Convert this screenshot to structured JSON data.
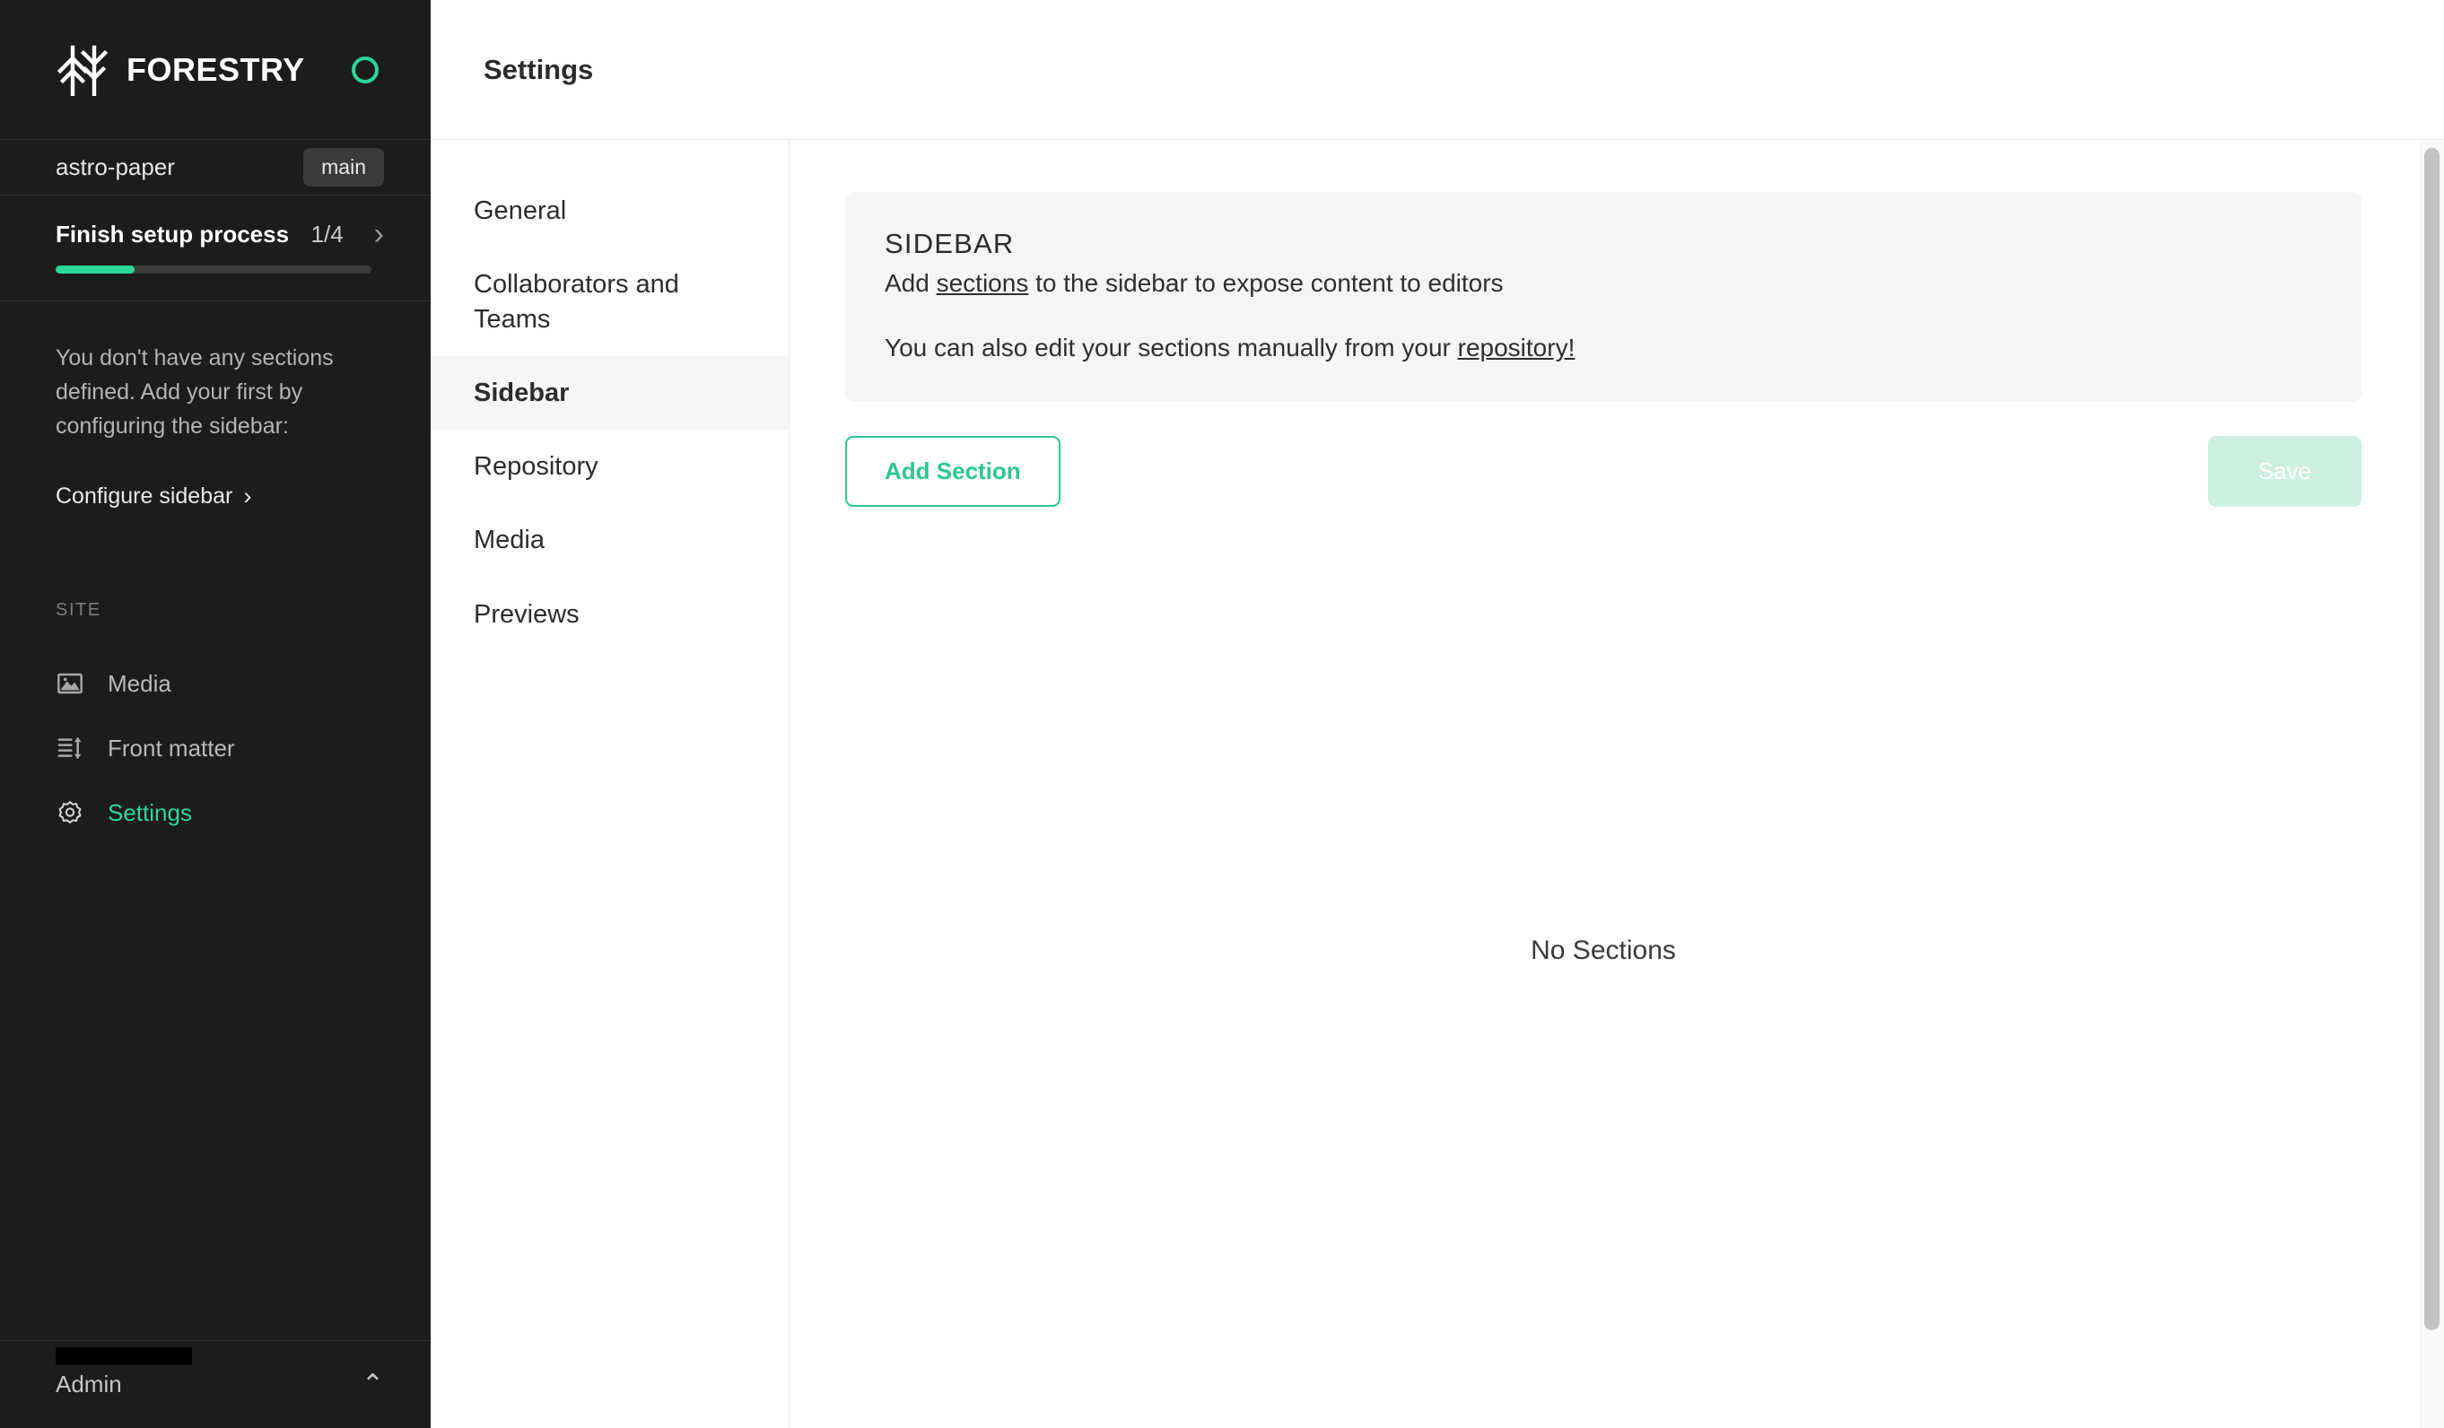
{
  "brand": {
    "name": "FORESTRY",
    "logo_icon": "forestry-trees-logo",
    "status_icon": "status-ring-icon",
    "accent_color": "#2dd89a"
  },
  "sidebar": {
    "repository": {
      "name": "astro-paper",
      "branch": "main"
    },
    "setup": {
      "title": "Finish setup process",
      "count": "1/4",
      "progress_percent": 25,
      "chevron_icon": "chevron-right-icon"
    },
    "empty": {
      "message": "You don't have any sections defined. Add your first by configuring the sidebar:",
      "cta": "Configure sidebar",
      "cta_chevron": "›"
    },
    "site": {
      "label": "SITE",
      "items": [
        {
          "label": "Media",
          "icon": "image-icon",
          "active": false
        },
        {
          "label": "Front matter",
          "icon": "front-matter-sort-icon",
          "active": false
        },
        {
          "label": "Settings",
          "icon": "gear-icon",
          "active": true
        }
      ]
    },
    "user": {
      "name": "Admin",
      "caret_icon": "chevron-up-icon"
    }
  },
  "header": {
    "title": "Settings"
  },
  "settings_nav": {
    "items": [
      {
        "label": "General",
        "active": false
      },
      {
        "label": "Collaborators and Teams",
        "active": false
      },
      {
        "label": "Sidebar",
        "active": true
      },
      {
        "label": "Repository",
        "active": false
      },
      {
        "label": "Media",
        "active": false
      },
      {
        "label": "Previews",
        "active": false
      }
    ]
  },
  "main": {
    "info": {
      "title": "SIDEBAR",
      "line1_prefix": "Add ",
      "line1_link": "sections",
      "line1_suffix": " to the sidebar to expose content to editors",
      "line2_prefix": "You can also edit your sections manually from your ",
      "line2_link": "repository!"
    },
    "buttons": {
      "add_section": "Add Section",
      "save": "Save"
    },
    "empty_state": "No Sections"
  }
}
